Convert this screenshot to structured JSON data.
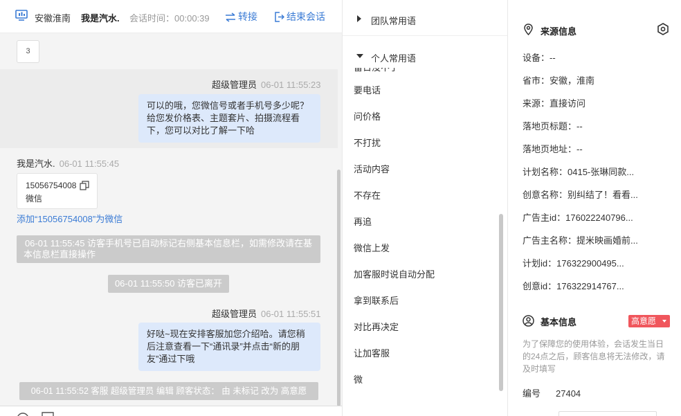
{
  "header": {
    "location": "安徽淮南",
    "visitor_name": "我是汽水.",
    "session_label": "会话时间：",
    "session_time": "00:00:39",
    "transfer_label": "转接",
    "end_label": "结束会话"
  },
  "chat": {
    "top_box_value": "3",
    "msg1": {
      "sender": "超级管理员",
      "time": "06-01 11:55:23",
      "lines": [
        "可以的哦，您微信号或者手机号多少呢？",
        "给您发价格表、主题套片、拍摄流程看",
        "下，您可以对比了解一下哈"
      ]
    },
    "msg2": {
      "sender": "我是汽水.",
      "time": "06-01 11:55:45",
      "card_number": "15056754008",
      "card_type": "微信",
      "add_link": "添加“15056754008”为微信"
    },
    "sys1": {
      "lines": [
        "06-01 11:55:45 访客手机号已自动标记右侧基本信息栏，如需修改请在基",
        "本信息栏直接操作"
      ]
    },
    "sys2": "06-01 11:55:50 访客已离开",
    "msg3": {
      "sender": "超级管理员",
      "time": "06-01 11:55:51",
      "lines": [
        "好哒~现在安排客服加您介绍哈。请您稍",
        "后注意查看一下“通讯录”并点击“新的朋",
        "友”通过下哦"
      ]
    },
    "sys3": "06-01 11:55:52 客服 超级管理员 编辑 顾客状态： 由 未标记 改为 高意愿"
  },
  "phrases": {
    "team_group": "团队常用语",
    "personal_group": "个人常用语",
    "partial_item": "留日没不了",
    "items": [
      "要电话",
      "问价格",
      "不打扰",
      "活动内容",
      "不存在",
      "再追",
      "微信上发",
      "加客服时说自动分配",
      "拿到联系后",
      "对比再决定",
      "让加客服",
      "微"
    ]
  },
  "info": {
    "source_title": "来源信息",
    "source_rows": [
      {
        "label": "设备：",
        "value": "--"
      },
      {
        "label": "省市：",
        "value": "安徽，淮南"
      },
      {
        "label": "来源：",
        "value": "直接访问"
      },
      {
        "label": "落地页标题：",
        "value": "--"
      },
      {
        "label": "落地页地址：",
        "value": "--"
      },
      {
        "label": "计划名称：",
        "value": "0415-张琳同款..."
      },
      {
        "label": "创意名称：",
        "value": "别纠结了！看看..."
      },
      {
        "label": "广告主id：",
        "value": "176022240796..."
      },
      {
        "label": "广告主名称：",
        "value": "提米映画婚前..."
      },
      {
        "label": "计划id：",
        "value": "176322900495..."
      },
      {
        "label": "创意id：",
        "value": "176322914767..."
      }
    ],
    "basic_title": "基本信息",
    "intent_badge": "高意愿",
    "note_lines": [
      "为了保障您的使用体验，会话发生当日",
      "的24点之后，顾客信息将无法修改，请",
      "及时填写"
    ],
    "id_label": "编号",
    "id_value": "27404"
  },
  "colors": {
    "link_blue": "#3a7bd5",
    "bubble_blue": "#dde9fb",
    "system_gray": "#cbcbcb",
    "badge_red": "#f0565c"
  },
  "icons": [
    "monitor-icon",
    "transfer-icon",
    "logout-icon",
    "copy-icon",
    "caret-right-icon",
    "caret-down-icon",
    "location-pin-icon",
    "settings-hex-icon",
    "user-circle-icon",
    "chevron-down-icon"
  ]
}
